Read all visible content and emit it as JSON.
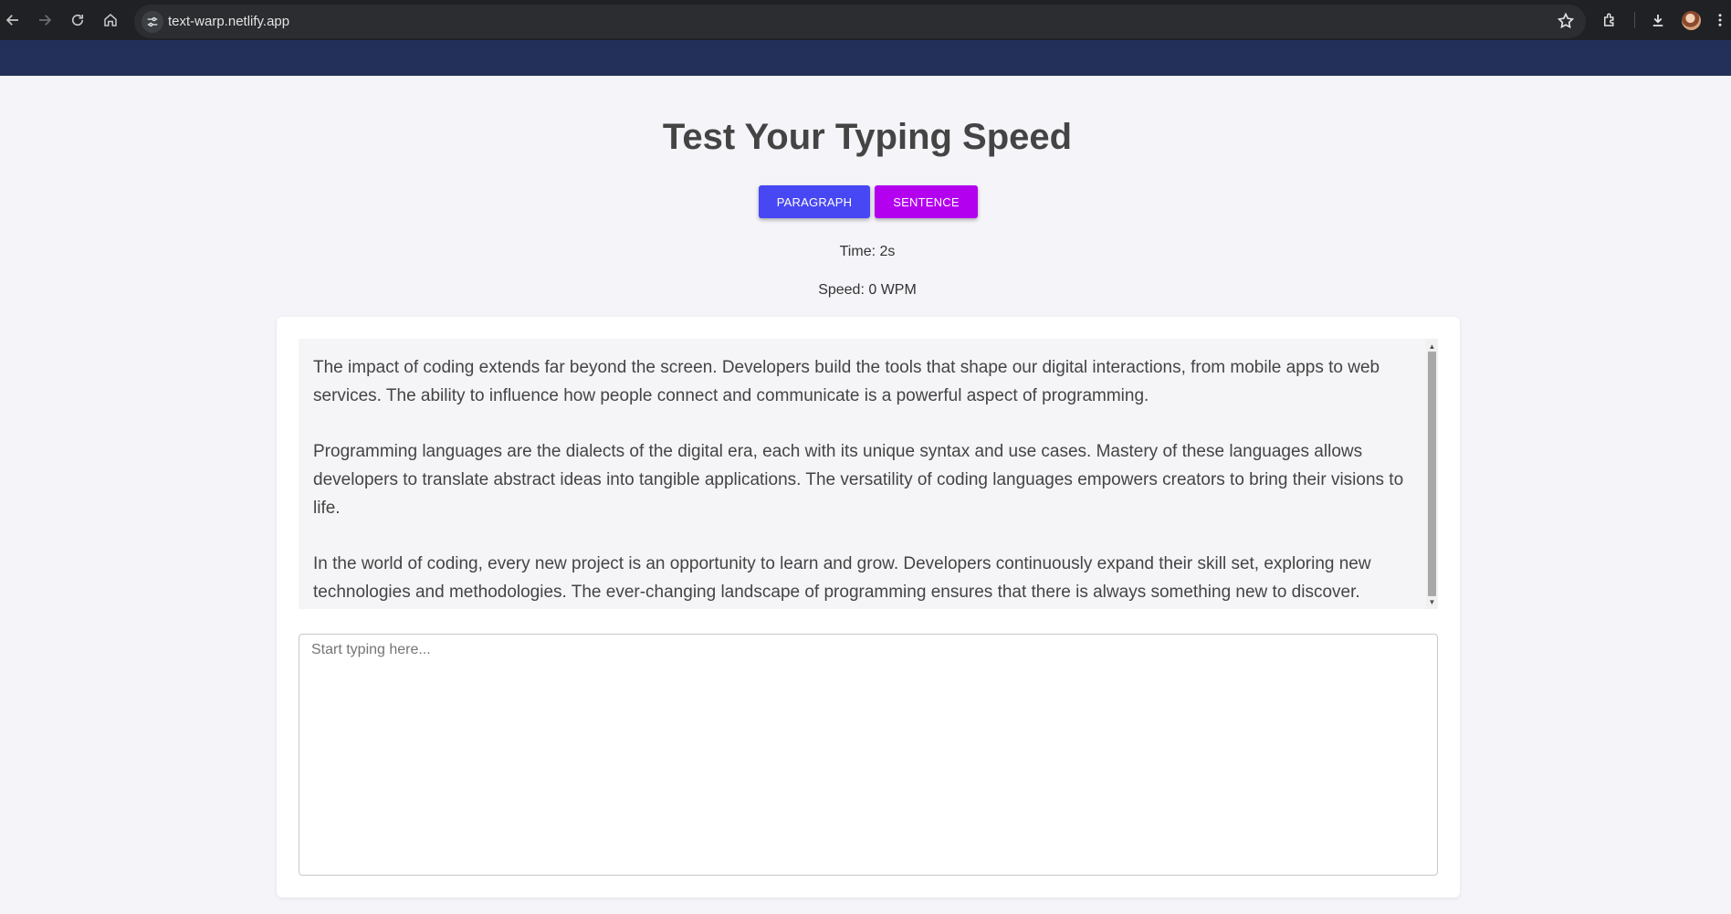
{
  "browser": {
    "url": "text-warp.netlify.app",
    "icons": [
      "back-icon",
      "forward-icon",
      "reload-icon",
      "home-icon",
      "site-settings-icon",
      "bookmark-star-icon",
      "extensions-icon",
      "download-icon",
      "profile-avatar",
      "menu-icon"
    ]
  },
  "page": {
    "title": "Test Your Typing Speed",
    "buttons": {
      "paragraph_label": "PARAGRAPH",
      "sentence_label": "SENTENCE"
    },
    "stats": {
      "time": "Time: 2s",
      "speed": "Speed: 0 WPM"
    },
    "text_paragraphs": [
      "The impact of coding extends far beyond the screen. Developers build the tools that shape our digital interactions, from mobile apps to web services. The ability to influence how people connect and communicate is a powerful aspect of programming.",
      "Programming languages are the dialects of the digital era, each with its unique syntax and use cases. Mastery of these languages allows developers to translate abstract ideas into tangible applications. The versatility of coding languages empowers creators to bring their visions to life.",
      "In the world of coding, every new project is an opportunity to learn and grow. Developers continuously expand their skill set, exploring new technologies and methodologies. The ever-changing landscape of programming ensures that there is always something new to discover."
    ],
    "input": {
      "placeholder": "Start typing here...",
      "value": ""
    }
  },
  "colors": {
    "header": "#23305a",
    "paragraph_button": "#4747f3",
    "sentence_button": "#b300ef",
    "background": "#f4f4f9"
  }
}
